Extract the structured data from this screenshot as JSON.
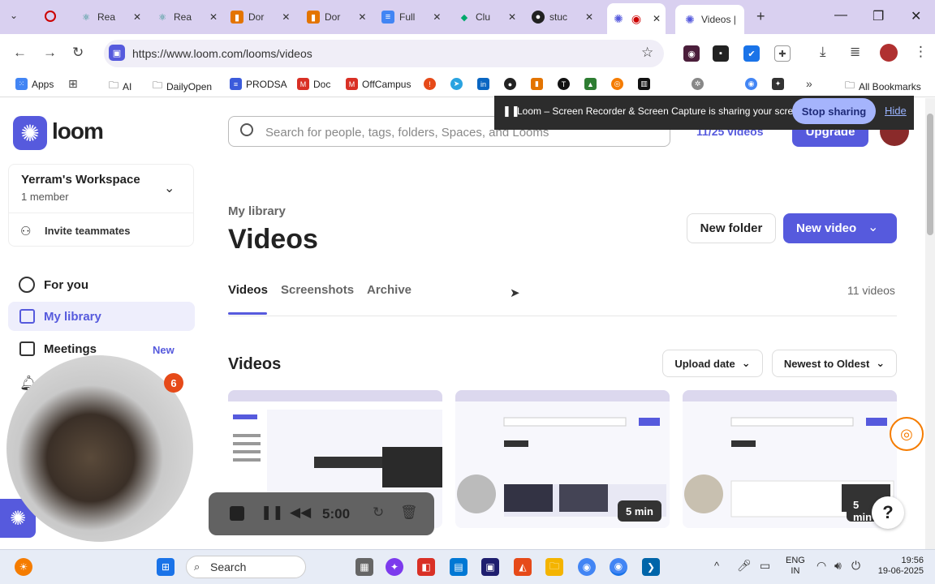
{
  "browser": {
    "tabs": [
      {
        "label": "Rea",
        "color": "#14877a"
      },
      {
        "label": "Rea",
        "color": "#14877a"
      },
      {
        "label": "Dor",
        "color": "#e37400"
      },
      {
        "label": "Dor",
        "color": "#e37400"
      },
      {
        "label": "Full",
        "color": "#4285f4"
      },
      {
        "label": "Clu",
        "color": "#00a86b"
      },
      {
        "label": "stuc",
        "color": "#222222"
      },
      {
        "label": "Videos |",
        "color": "#565ADD"
      }
    ],
    "url": "https://www.loom.com/looms/videos",
    "bookmarks": [
      {
        "label": "Apps",
        "color": "#4285f4"
      },
      {
        "label": "AI",
        "color": "#333333"
      },
      {
        "label": "DailyOpen",
        "color": "#333333"
      },
      {
        "label": "PRODSA",
        "color": "#3b5bdb"
      },
      {
        "label": "Doc",
        "color": "#d93025"
      },
      {
        "label": "OffCampus",
        "color": "#d93025"
      }
    ],
    "all_bookmarks": "All Bookmarks"
  },
  "share_banner": {
    "text": "Loom – Screen Recorder & Screen Capture is sharing your screen.",
    "stop_label": "Stop sharing",
    "hide_label": "Hide"
  },
  "header": {
    "logo_text": "loom",
    "search_placeholder": "Search for people, tags, folders, Spaces, and Looms",
    "video_count_pill": "11/25 videos",
    "upgrade_label": "Upgrade"
  },
  "sidebar": {
    "workspace_name": "Yerram's Workspace",
    "workspace_members": "1 member",
    "invite_label": "Invite teammates",
    "items": [
      {
        "label": "For you"
      },
      {
        "label": "My library"
      },
      {
        "label": "Meetings",
        "badge": "New"
      }
    ],
    "notification_count": "6"
  },
  "main": {
    "breadcrumb": "My library",
    "title": "Videos",
    "new_folder_label": "New folder",
    "new_video_label": "New video",
    "tabs": [
      {
        "label": "Videos"
      },
      {
        "label": "Screenshots"
      },
      {
        "label": "Archive"
      }
    ],
    "total_videos": "11 videos",
    "section_title": "Videos",
    "sort_field": "Upload date",
    "sort_order": "Newest to Oldest",
    "cards": [
      {
        "duration": ""
      },
      {
        "duration": "5 min"
      },
      {
        "duration": "5 min"
      }
    ]
  },
  "recorder": {
    "timer": "5:00"
  },
  "taskbar": {
    "search_label": "Search",
    "lang": "ENG",
    "region": "IN",
    "time": "19:56",
    "date": "19-06-2025"
  },
  "colors": {
    "brand": "#565ADD",
    "tab_strip": "#d9d0f0",
    "banner": "#2c2c2c",
    "stop_button": "#a5b4fc"
  }
}
